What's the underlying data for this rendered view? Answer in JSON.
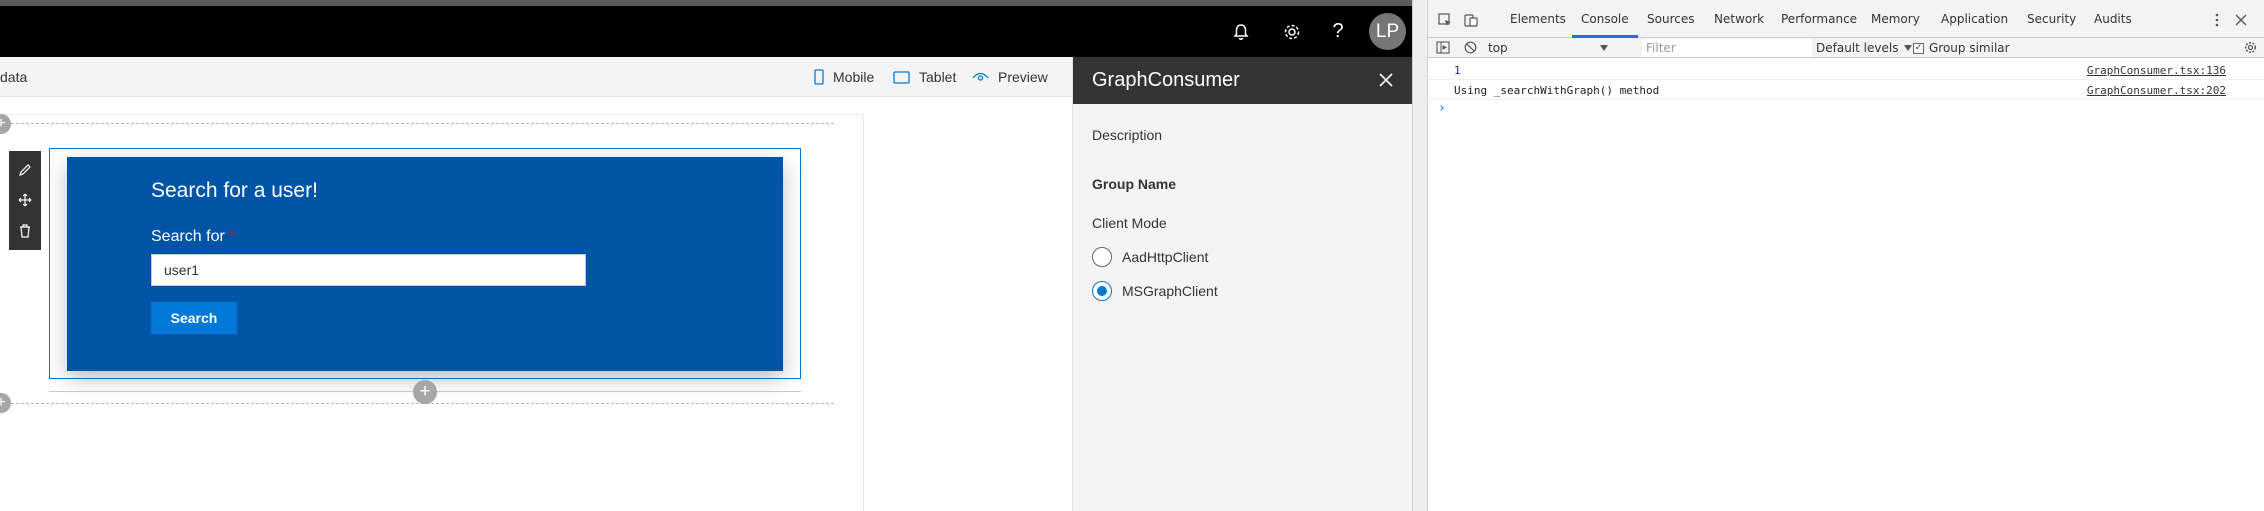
{
  "suitebar": {
    "avatar_initials": "LP",
    "icons": [
      "bell-icon",
      "gear-icon",
      "help-icon"
    ],
    "help_glyph": "?"
  },
  "commandbar": {
    "left_text": "data",
    "mobile": "Mobile",
    "tablet": "Tablet",
    "preview": "Preview"
  },
  "webpart": {
    "title": "Search for a user!",
    "search_label": "Search for",
    "required_marker": "*",
    "input_value": "user1",
    "button_label": "Search",
    "bg_color": "#0054a6",
    "button_color": "#0078d7"
  },
  "property_pane": {
    "title": "GraphConsumer",
    "description_label": "Description",
    "group_name_label": "Group Name",
    "client_mode_label": "Client Mode",
    "options": [
      {
        "label": "AadHttpClient",
        "checked": false
      },
      {
        "label": "MSGraphClient",
        "checked": true
      }
    ]
  },
  "devtools": {
    "tabs": [
      "Elements",
      "Console",
      "Sources",
      "Network",
      "Performance",
      "Memory",
      "Application",
      "Security",
      "Audits"
    ],
    "active_tab": "Console",
    "context": "top",
    "filter_placeholder": "Filter",
    "levels": "Default levels",
    "group_similar": "Group similar",
    "console_lines": [
      {
        "message": "1",
        "source": "GraphConsumer.tsx:136"
      },
      {
        "message": "Using _searchWithGraph() method",
        "source": "GraphConsumer.tsx:202"
      }
    ],
    "prompt": "›",
    "accent_color": "#1a73e8"
  }
}
